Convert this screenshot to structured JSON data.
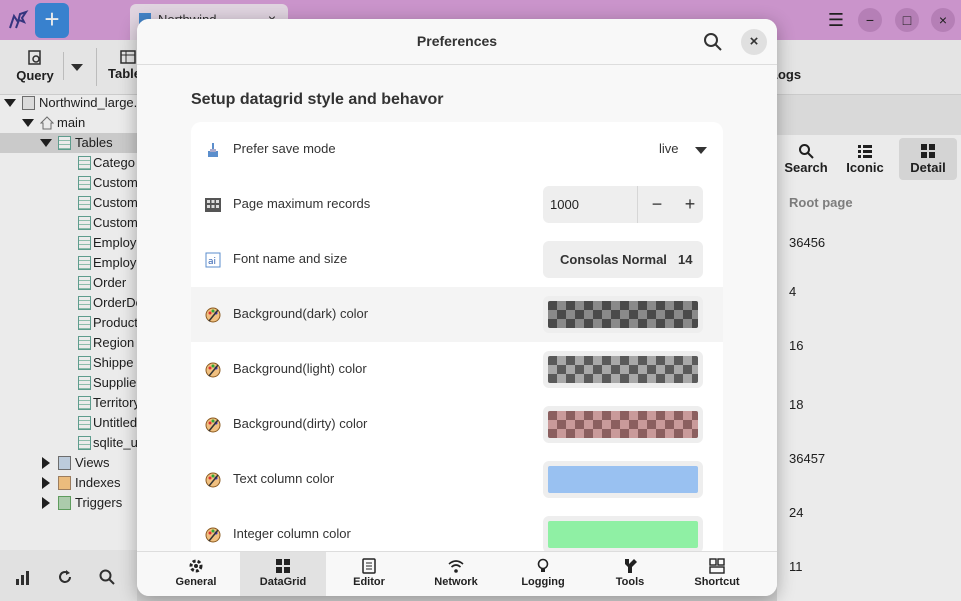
{
  "window": {
    "tab_title": "Northwind",
    "new_label": "+",
    "close_tab": "×",
    "menu": "☰",
    "minimize": "−",
    "maximize": "□",
    "close": "×"
  },
  "toolbar": {
    "query_label": "Query",
    "table_label": "Table",
    "logs_label": "Logs"
  },
  "sidebar": {
    "db_name": "Northwind_large.",
    "schema": "main",
    "tables_label": "Tables",
    "tables": [
      "Catego",
      "Custom",
      "Custom",
      "Custom",
      "Employ",
      "Employ",
      "Order",
      "OrderDe",
      "Product",
      "Region",
      "Shippe",
      "Supplie",
      "Territory",
      "Untitled",
      "sqlite_u"
    ],
    "views_label": "Views",
    "indexes_label": "Indexes",
    "triggers_label": "Triggers"
  },
  "right_panel": {
    "view_search": "Search",
    "view_iconic": "Iconic",
    "view_detail": "Detail",
    "column_header": "Root page",
    "values": [
      "36456",
      "4",
      "16",
      "18",
      "36457",
      "24",
      "11"
    ]
  },
  "dialog": {
    "title": "Preferences",
    "close_label": "×",
    "section_title": "Setup datagrid style and behavor",
    "save_mode": {
      "label": "Prefer save mode",
      "value": "live"
    },
    "page_max": {
      "label": "Page maximum records",
      "value": "1000",
      "minus": "−",
      "plus": "+"
    },
    "font": {
      "label": "Font name and size",
      "name": "Consolas Normal",
      "size": "14"
    },
    "bg_dark": {
      "label": "Background(dark) color"
    },
    "bg_light": {
      "label": "Background(light) color"
    },
    "bg_dirty": {
      "label": "Background(dirty) color"
    },
    "text_col": {
      "label": "Text column color",
      "color": "#99c1f1"
    },
    "int_col": {
      "label": "Integer column color",
      "color": "#8ff0a4"
    },
    "footer_tabs": {
      "general": "General",
      "datagrid": "DataGrid",
      "editor": "Editor",
      "network": "Network",
      "logging": "Logging",
      "tools": "Tools",
      "shortcut": "Shortcut"
    }
  },
  "colors": {
    "titlebar": "#dca1dd",
    "accent": "#3d8de0"
  }
}
